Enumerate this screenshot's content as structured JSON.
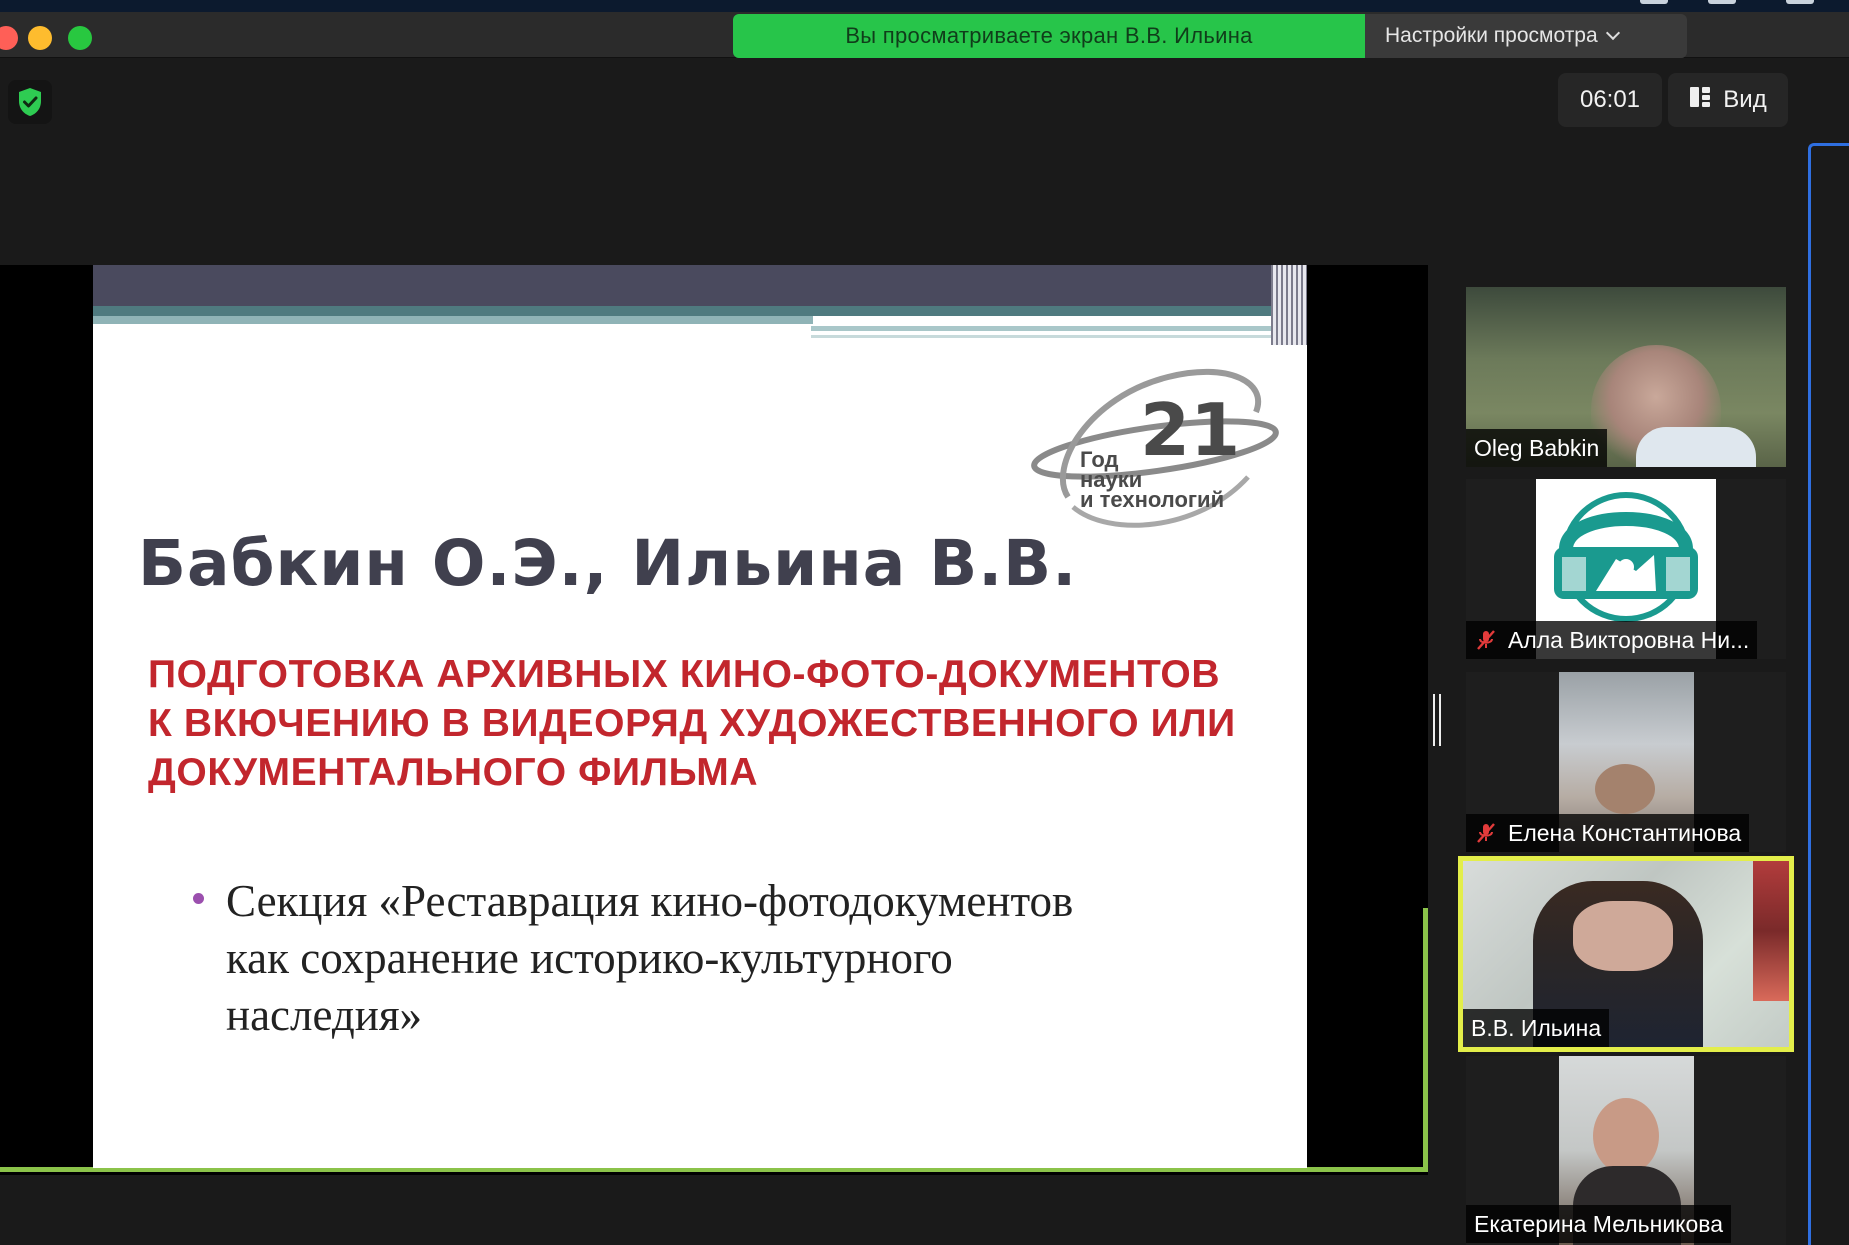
{
  "banner": {
    "viewing_text": "Вы просматриваете экран В.В. Ильина",
    "settings_label": "Настройки просмотра"
  },
  "meeting": {
    "timer": "06:01",
    "view_label": "Вид"
  },
  "slide": {
    "authors": "Бабкин О.Э., Ильина В.В.",
    "topic_lines": [
      "ПОДГОТОВКА АРХИВНЫХ КИНО-ФОТО-ДОКУМЕНТОВ",
      "К ВКЮЧЕНИЮ В ВИДЕОРЯД ХУДОЖЕСТВЕННОГО ИЛИ",
      "ДОКУМЕНТАЛЬНОГО ФИЛЬМА"
    ],
    "bullet_lines": [
      "Секция «Реставрация кино-фотодокументов",
      "как сохранение историко-культурного",
      "наследия»"
    ],
    "logo": {
      "number": "21",
      "line1": "Год",
      "line2": "науки",
      "line3": "и технологий"
    }
  },
  "participants": [
    {
      "name": "Oleg Babkin",
      "muted": false,
      "active": false
    },
    {
      "name": "Алла Викторовна Ни...",
      "muted": true,
      "active": false
    },
    {
      "name": "Елена Константинова",
      "muted": true,
      "active": false
    },
    {
      "name": "В.В. Ильина",
      "muted": false,
      "active": true
    },
    {
      "name": "Екатерина Мельникова",
      "muted": false,
      "active": false
    }
  ],
  "colors": {
    "banner_green": "#27c54a",
    "active_speaker_border": "#e3ee4a",
    "share_border": "#8bc34a",
    "topic_red": "#c2262d",
    "mute_red": "#e23b3b"
  }
}
